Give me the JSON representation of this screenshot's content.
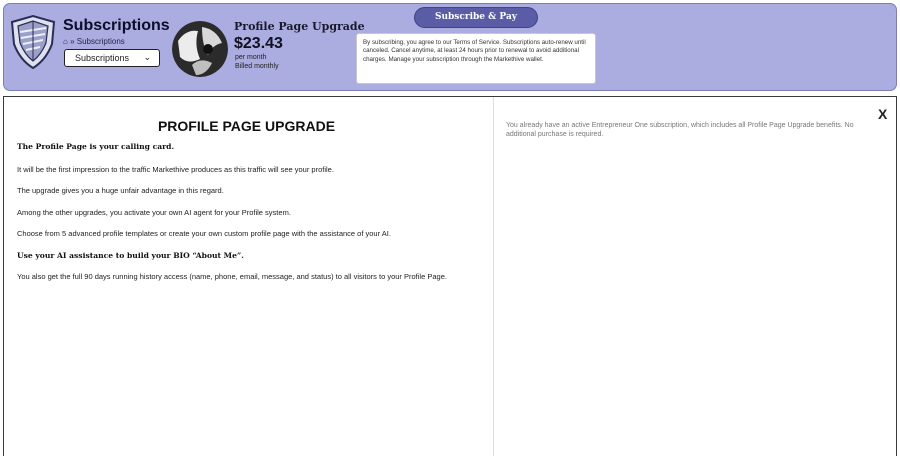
{
  "header": {
    "title": "Subscriptions",
    "breadcrumb": "» Subscriptions",
    "home_icon": "home-icon",
    "select": {
      "value": "Subscriptions"
    },
    "product": {
      "title": "Profile Page Upgrade",
      "price": "$23.43",
      "per": "per month",
      "billed": "Billed monthly"
    },
    "subscribe_label": "Subscribe & Pay",
    "terms": "By subscribing, you agree to our Terms of Service. Subscriptions auto-renew until canceled. Cancel anytime, at least 24 hours prior to renewal to avoid additional charges. Manage your subscription through the Markethive wallet."
  },
  "main": {
    "heading": "PROFILE PAGE UPGRADE",
    "paragraphs": [
      "The Profile Page is your calling card.",
      "It will be the first impression to the traffic Markethive produces as this traffic will see your profile.",
      "The upgrade gives you a huge unfair advantage in this regard.",
      "Among the other upgrades, you activate your own AI agent for your Profile system.",
      "Choose from 5 advanced profile templates or create your own custom profile page with the assistance of your AI.",
      "Use your AI assistance to build your BIO “About Me”.",
      "You also get the full 90 days running history access (name, phone, email, message, and status) to all visitors to your Profile Page."
    ],
    "notice": "You already have an active Entrepreneur One subscription, which includes all Profile Page Upgrade benefits. No additional purchase is required.",
    "close_label": "X"
  },
  "colors": {
    "header_bg": "#abacdf",
    "button_bg": "#5a5da6"
  }
}
